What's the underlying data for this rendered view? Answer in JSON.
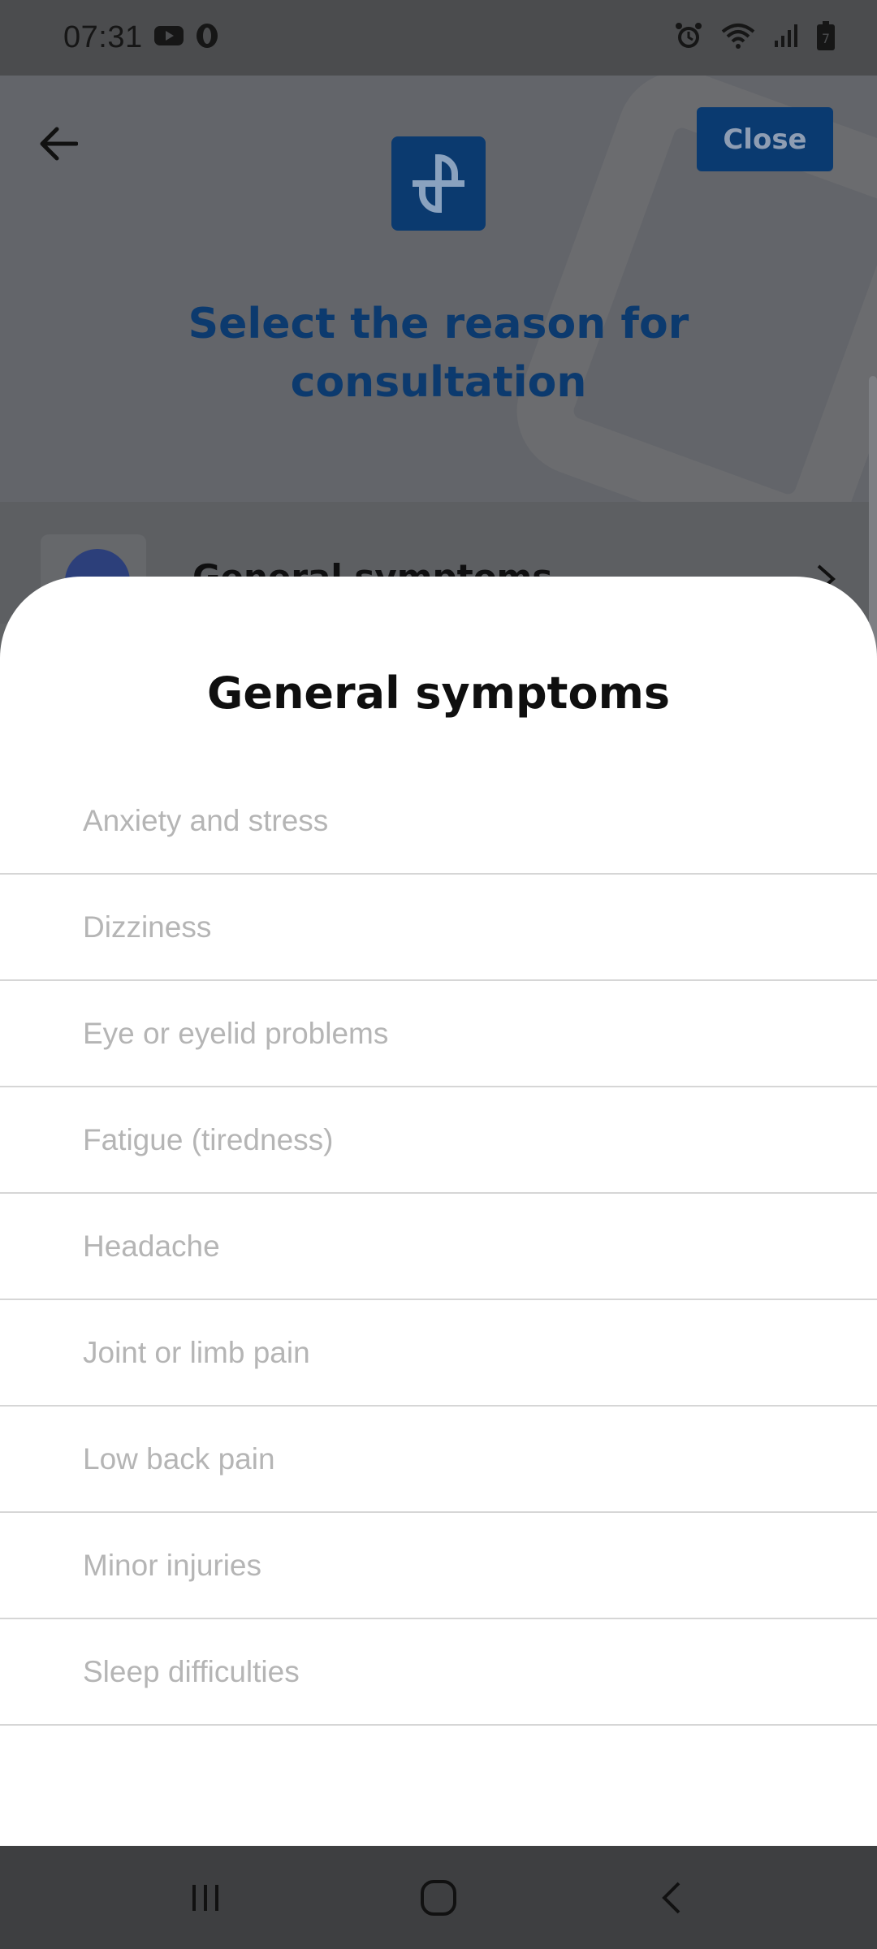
{
  "status_bar": {
    "time": "07:31",
    "left_icons": [
      "youtube-icon",
      "opera-icon"
    ],
    "right_icons": [
      "alarm-icon",
      "wifi-icon",
      "signal-icon",
      "battery-icon"
    ]
  },
  "header": {
    "close_label": "Close",
    "title": "Select the reason for consultation"
  },
  "background_list": {
    "first_item_label": "General symptoms"
  },
  "sheet": {
    "title": "General symptoms",
    "items": [
      {
        "label": "Anxiety and stress"
      },
      {
        "label": "Dizziness"
      },
      {
        "label": "Eye or eyelid problems"
      },
      {
        "label": "Fatigue (tiredness)"
      },
      {
        "label": "Headache"
      },
      {
        "label": "Joint or limb pain"
      },
      {
        "label": "Low back pain"
      },
      {
        "label": "Minor injuries"
      },
      {
        "label": "Sleep difficulties"
      }
    ]
  },
  "nav_bar": {
    "buttons": [
      "recents-icon",
      "home-icon",
      "back-icon"
    ]
  },
  "colors": {
    "brand": "#0b3a6f",
    "sheet_bg": "#ffffff",
    "item_text": "#b5b5b5"
  }
}
